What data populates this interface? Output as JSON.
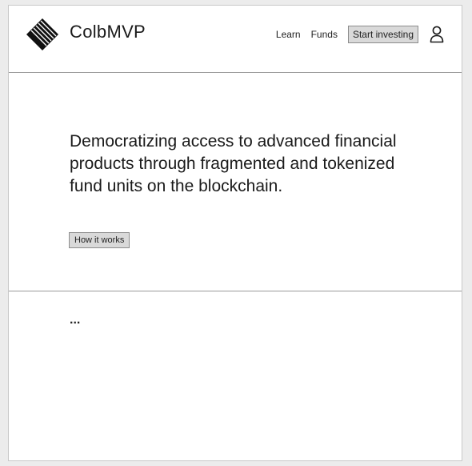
{
  "header": {
    "brand": "ColbMVP",
    "logo_icon": "diamond-stripes-logo-icon",
    "nav": {
      "learn": "Learn",
      "funds": "Funds",
      "start_investing": "Start investing"
    },
    "user_icon": "user-icon"
  },
  "hero": {
    "headline": "Democratizing access to advanced financial products through fragmented and tokenized fund units on the blockchain.",
    "how_it_works": "How it works"
  },
  "section2": {
    "placeholder": "..."
  },
  "colors": {
    "page_bg": "#ececec",
    "frame_bg": "#ffffff",
    "button_bg": "#d9d9d9",
    "divider": "#9a9a9a",
    "text": "#1e1e1e"
  }
}
